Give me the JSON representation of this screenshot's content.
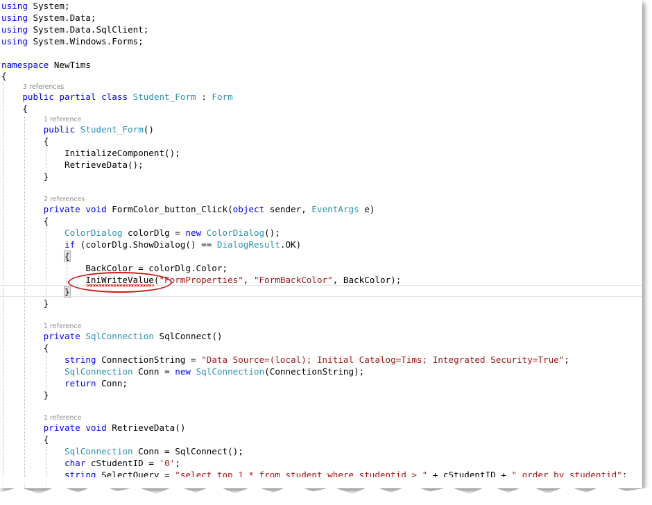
{
  "editor": {
    "lines": [
      {
        "id": "l01",
        "segments": [
          {
            "t": "kw",
            "v": "using"
          },
          {
            "t": "pl",
            "v": " System;"
          }
        ]
      },
      {
        "id": "l02",
        "segments": [
          {
            "t": "kw",
            "v": "using"
          },
          {
            "t": "pl",
            "v": " System.Data;"
          }
        ]
      },
      {
        "id": "l03",
        "segments": [
          {
            "t": "kw",
            "v": "using"
          },
          {
            "t": "pl",
            "v": " System.Data.SqlClient;"
          }
        ]
      },
      {
        "id": "l04",
        "segments": [
          {
            "t": "kw",
            "v": "using"
          },
          {
            "t": "pl",
            "v": " System.Windows.Forms;"
          }
        ]
      },
      {
        "id": "l05",
        "segments": [
          {
            "t": "kw",
            "v": "namespace"
          },
          {
            "t": "pl",
            "v": " NewTims"
          }
        ]
      },
      {
        "id": "l06",
        "segments": [
          {
            "t": "pl",
            "v": "{"
          }
        ]
      },
      {
        "id": "l07",
        "segments": [
          {
            "t": "pl",
            "v": "    "
          },
          {
            "t": "kw",
            "v": "public"
          },
          {
            "t": "pl",
            "v": " "
          },
          {
            "t": "kw",
            "v": "partial"
          },
          {
            "t": "pl",
            "v": " "
          },
          {
            "t": "kw",
            "v": "class"
          },
          {
            "t": "pl",
            "v": " "
          },
          {
            "t": "ty",
            "v": "Student_Form"
          },
          {
            "t": "pl",
            "v": " : "
          },
          {
            "t": "ty",
            "v": "Form"
          }
        ]
      },
      {
        "id": "l08",
        "segments": [
          {
            "t": "pl",
            "v": "    {"
          }
        ]
      },
      {
        "id": "l09",
        "segments": [
          {
            "t": "pl",
            "v": "        "
          },
          {
            "t": "kw",
            "v": "public"
          },
          {
            "t": "pl",
            "v": " "
          },
          {
            "t": "ty",
            "v": "Student_Form"
          },
          {
            "t": "pl",
            "v": "()"
          }
        ]
      },
      {
        "id": "l10",
        "segments": [
          {
            "t": "pl",
            "v": "        {"
          }
        ]
      },
      {
        "id": "l11",
        "segments": [
          {
            "t": "pl",
            "v": "            InitializeComponent();"
          }
        ]
      },
      {
        "id": "l12",
        "segments": [
          {
            "t": "pl",
            "v": "            RetrieveData();"
          }
        ]
      },
      {
        "id": "l13",
        "segments": [
          {
            "t": "pl",
            "v": "        }"
          }
        ]
      },
      {
        "id": "l14",
        "segments": [
          {
            "t": "pl",
            "v": "        "
          },
          {
            "t": "kw",
            "v": "private"
          },
          {
            "t": "pl",
            "v": " "
          },
          {
            "t": "kw",
            "v": "void"
          },
          {
            "t": "pl",
            "v": " FormColor_button_Click("
          },
          {
            "t": "kw",
            "v": "object"
          },
          {
            "t": "pl",
            "v": " sender, "
          },
          {
            "t": "ty",
            "v": "EventArgs"
          },
          {
            "t": "pl",
            "v": " e)"
          }
        ]
      },
      {
        "id": "l15",
        "segments": [
          {
            "t": "pl",
            "v": "        {"
          }
        ]
      },
      {
        "id": "l16",
        "segments": [
          {
            "t": "pl",
            "v": "            "
          },
          {
            "t": "ty",
            "v": "ColorDialog"
          },
          {
            "t": "pl",
            "v": " colorDlg = "
          },
          {
            "t": "kw",
            "v": "new"
          },
          {
            "t": "pl",
            "v": " "
          },
          {
            "t": "ty",
            "v": "ColorDialog"
          },
          {
            "t": "pl",
            "v": "();"
          }
        ]
      },
      {
        "id": "l17",
        "segments": [
          {
            "t": "pl",
            "v": "            "
          },
          {
            "t": "kw",
            "v": "if"
          },
          {
            "t": "pl",
            "v": " (colorDlg.ShowDialog() == "
          },
          {
            "t": "ty",
            "v": "DialogResult"
          },
          {
            "t": "pl",
            "v": ".OK)"
          }
        ]
      },
      {
        "id": "l18",
        "segments": [
          {
            "t": "pl",
            "v": "            "
          },
          {
            "t": "hl",
            "v": "{"
          }
        ]
      },
      {
        "id": "l19",
        "segments": [
          {
            "t": "pl",
            "v": "                BackColor = colorDlg.Color;"
          }
        ]
      },
      {
        "id": "l20",
        "segments": [
          {
            "t": "pl",
            "v": "                IniWriteValue("
          },
          {
            "t": "str",
            "v": "\"FormProperties\""
          },
          {
            "t": "pl",
            "v": ", "
          },
          {
            "t": "str",
            "v": "\"FormBackColor\""
          },
          {
            "t": "pl",
            "v": ", BackColor);"
          }
        ]
      },
      {
        "id": "l21",
        "segments": [
          {
            "t": "pl",
            "v": "            "
          },
          {
            "t": "hl",
            "v": "}"
          }
        ]
      },
      {
        "id": "l22",
        "segments": [
          {
            "t": "pl",
            "v": "        }"
          }
        ]
      },
      {
        "id": "l23",
        "segments": [
          {
            "t": "pl",
            "v": "        "
          },
          {
            "t": "kw",
            "v": "private"
          },
          {
            "t": "pl",
            "v": " "
          },
          {
            "t": "ty",
            "v": "SqlConnection"
          },
          {
            "t": "pl",
            "v": " SqlConnect()"
          }
        ]
      },
      {
        "id": "l24",
        "segments": [
          {
            "t": "pl",
            "v": "        {"
          }
        ]
      },
      {
        "id": "l25",
        "segments": [
          {
            "t": "pl",
            "v": "            "
          },
          {
            "t": "kw",
            "v": "string"
          },
          {
            "t": "pl",
            "v": " ConnectionString = "
          },
          {
            "t": "str",
            "v": "\"Data Source=(local); Initial Catalog=Tims; Integrated Security=True\""
          },
          {
            "t": "pl",
            "v": ";"
          }
        ]
      },
      {
        "id": "l26",
        "segments": [
          {
            "t": "pl",
            "v": "            "
          },
          {
            "t": "ty",
            "v": "SqlConnection"
          },
          {
            "t": "pl",
            "v": " Conn = "
          },
          {
            "t": "kw",
            "v": "new"
          },
          {
            "t": "pl",
            "v": " "
          },
          {
            "t": "ty",
            "v": "SqlConnection"
          },
          {
            "t": "pl",
            "v": "(ConnectionString);"
          }
        ]
      },
      {
        "id": "l27",
        "segments": [
          {
            "t": "pl",
            "v": "            "
          },
          {
            "t": "kw",
            "v": "return"
          },
          {
            "t": "pl",
            "v": " Conn;"
          }
        ]
      },
      {
        "id": "l28",
        "segments": [
          {
            "t": "pl",
            "v": "        }"
          }
        ]
      },
      {
        "id": "l29",
        "segments": [
          {
            "t": "pl",
            "v": "        "
          },
          {
            "t": "kw",
            "v": "private"
          },
          {
            "t": "pl",
            "v": " "
          },
          {
            "t": "kw",
            "v": "void"
          },
          {
            "t": "pl",
            "v": " RetrieveData()"
          }
        ]
      },
      {
        "id": "l30",
        "segments": [
          {
            "t": "pl",
            "v": "        {"
          }
        ]
      },
      {
        "id": "l31",
        "segments": [
          {
            "t": "pl",
            "v": "            "
          },
          {
            "t": "ty",
            "v": "SqlConnection"
          },
          {
            "t": "pl",
            "v": " Conn = SqlConnect();"
          }
        ]
      },
      {
        "id": "l32",
        "segments": [
          {
            "t": "pl",
            "v": "            "
          },
          {
            "t": "kw",
            "v": "char"
          },
          {
            "t": "pl",
            "v": " cStudentID = "
          },
          {
            "t": "str",
            "v": "'0'"
          },
          {
            "t": "pl",
            "v": ";"
          }
        ]
      },
      {
        "id": "l33",
        "segments": [
          {
            "t": "pl",
            "v": "            "
          },
          {
            "t": "kw",
            "v": "string"
          },
          {
            "t": "pl",
            "v": " SelectQuery = "
          },
          {
            "t": "str",
            "v": "\"select top 1 * from student where studentid > \""
          },
          {
            "t": "pl",
            "v": " + cStudentID + "
          },
          {
            "t": "str",
            "v": "\" order by studentid\""
          },
          {
            "t": "pl",
            "v": ";"
          }
        ]
      }
    ],
    "codelens": {
      "class_refs": "3 references",
      "ctor_refs": "1 reference",
      "click_refs": "2 references",
      "sqlconnect_refs": "1 reference",
      "retrieve_refs": "1 reference"
    }
  },
  "colors": {
    "keyword": "#0000ff",
    "type": "#2b91af",
    "string": "#a31515",
    "codelens": "#8a8a8a",
    "annotation": "#d01818"
  }
}
